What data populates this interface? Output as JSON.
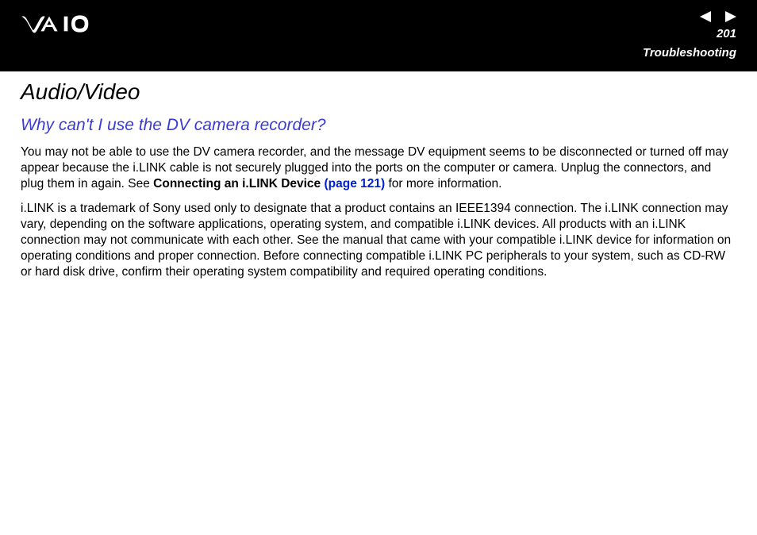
{
  "header": {
    "page_number": "201",
    "section": "Troubleshooting"
  },
  "content": {
    "title": "Audio/Video",
    "subtitle": "Why can't I use the DV camera recorder?",
    "para1_a": "You may not be able to use the DV camera recorder, and the message DV equipment seems to be disconnected or turned off may appear because the i.LINK cable is not securely plugged into the ports on the computer or camera. Unplug the connectors, and plug them in again. See ",
    "para1_bold": "Connecting an i.LINK Device ",
    "para1_link": "(page 121)",
    "para1_b": " for more information.",
    "para2": "i.LINK is a trademark of Sony used only to designate that a product contains an IEEE1394 connection. The i.LINK connection may vary, depending on the software applications, operating system, and compatible i.LINK devices. All products with an i.LINK connection may not communicate with each other. See the manual that came with your compatible i.LINK device for information on operating conditions and proper connection. Before connecting compatible i.LINK PC peripherals to your system, such as CD-RW or hard disk drive, confirm their operating system compatibility and required operating conditions."
  }
}
